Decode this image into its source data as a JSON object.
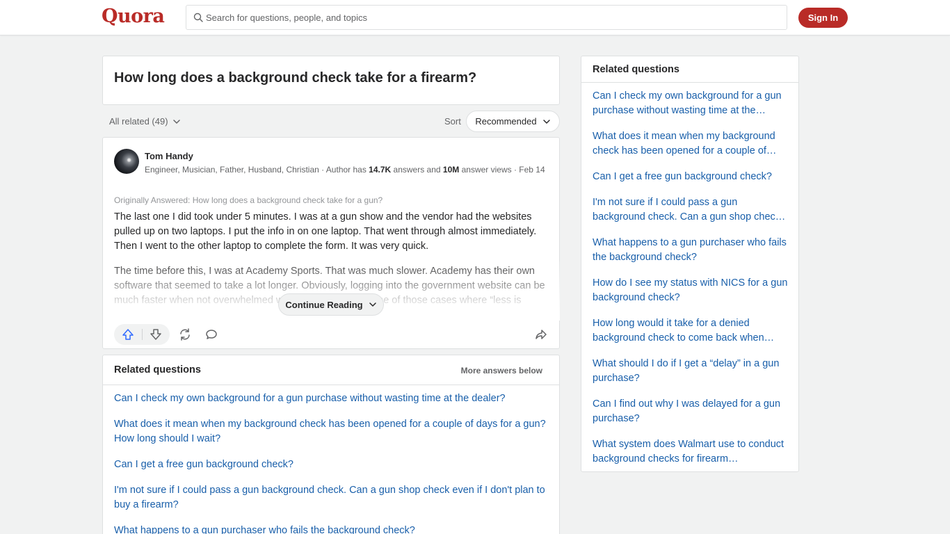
{
  "header": {
    "logo": "Quora",
    "search_placeholder": "Search for questions, people, and topics",
    "signin_label": "Sign In"
  },
  "question": {
    "title": "How long does a background check take for a firearm?"
  },
  "filters": {
    "all_related": "All related (49)",
    "sort_label": "Sort",
    "sort_value": "Recommended"
  },
  "answer": {
    "author_name": "Tom Handy",
    "cred_prefix": "Engineer, Musician, Father, Husband, Christian · Author has ",
    "answers_count": "14.7K",
    "cred_mid": " answers and ",
    "views_count": "10M",
    "cred_suffix": " answer views · ",
    "date": "Feb 14",
    "originally_answered": "Originally Answered: How long does a background check take for a gun?",
    "paragraph_1": "The last one I did took under 5 minutes. I was at a gun show and the vendor had the websites pulled up on two laptops. I put the info in on one laptop. That went through almost immediately. Then I went to the other laptop to complete the form. It was very quick.",
    "paragraph_2": "The time before this, I was at Academy Sports. That was much slower. Academy has their own software that seemed to take a lot longer. Obviously, logging into the government website can be much faster when not overwhelmed with transactions. It's one of those cases where “less is more”. The small mom-and-pop vendor using the free governme",
    "continue_label": "Continue Reading",
    "icons": [
      "upvote-icon",
      "downvote-icon",
      "share-repost-icon",
      "comment-icon",
      "share-icon"
    ]
  },
  "related_inline": {
    "title": "Related questions",
    "more_label": "More answers below",
    "items": [
      "Can I check my own background for a gun purchase without wasting time at the dealer?",
      "What does it mean when my background check has been opened for a couple of days for a gun? How long should I wait?",
      "Can I get a free gun background check?",
      "I'm not sure if I could pass a gun background check. Can a gun shop check even if I don't plan to buy a firearm?",
      "What happens to a gun purchaser who fails the background check?"
    ]
  },
  "sidebar": {
    "title": "Related questions",
    "items": [
      "Can I check my own background for a gun purchase without wasting time at the…",
      "What does it mean when my background check has been opened for a couple of…",
      "Can I get a free gun background check?",
      "I'm not sure if I could pass a gun background check. Can a gun shop chec…",
      "What happens to a gun purchaser who fails the background check?",
      "How do I see my status with NICS for a gun background check?",
      "How long would it take for a denied background check to come back when…",
      "What should I do if I get a “delay” in a gun purchase?",
      "Can I find out why I was delayed for a gun purchase?",
      "What system does Walmart use to conduct background checks for firearm…"
    ]
  },
  "colors": {
    "brand": "#b92b27",
    "link": "#195faa",
    "background": "#f1f2f2",
    "upvote": "#2e69ff"
  }
}
